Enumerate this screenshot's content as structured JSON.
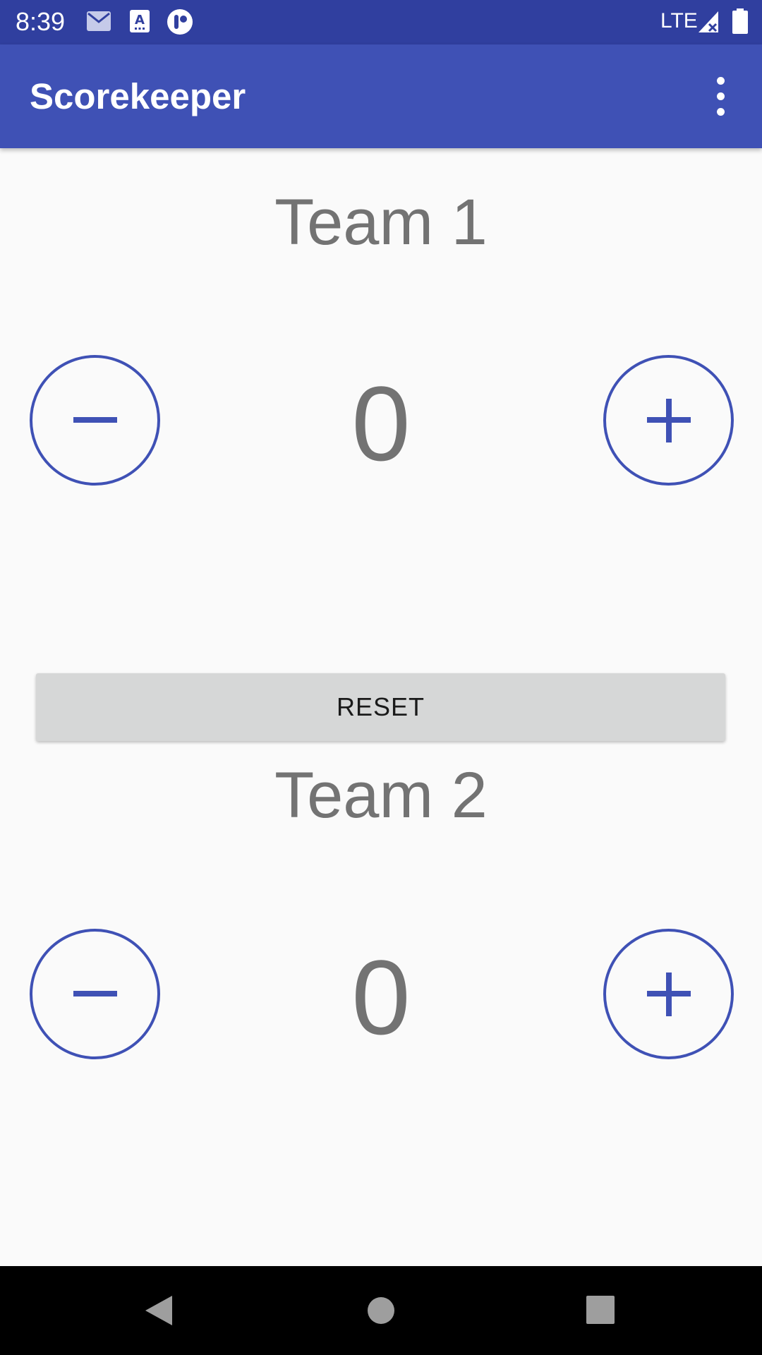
{
  "status_bar": {
    "time": "8:39",
    "network": "LTE",
    "icons": [
      "mail-icon",
      "keyboard-a-icon",
      "record-icon",
      "signal-icon",
      "battery-icon"
    ]
  },
  "app_bar": {
    "title": "Scorekeeper",
    "menu_icon": "more-vert-icon"
  },
  "teams": [
    {
      "name": "Team 1",
      "score": "0"
    },
    {
      "name": "Team 2",
      "score": "0"
    }
  ],
  "reset_label": "RESET",
  "colors": {
    "status_bar": "#303f9f",
    "primary": "#3f51b5",
    "text_gray": "#737373",
    "background": "#fafafa",
    "button_gray": "#d6d7d7"
  },
  "nav_bar": {
    "icons": [
      "back-icon",
      "home-icon",
      "recents-icon"
    ]
  }
}
